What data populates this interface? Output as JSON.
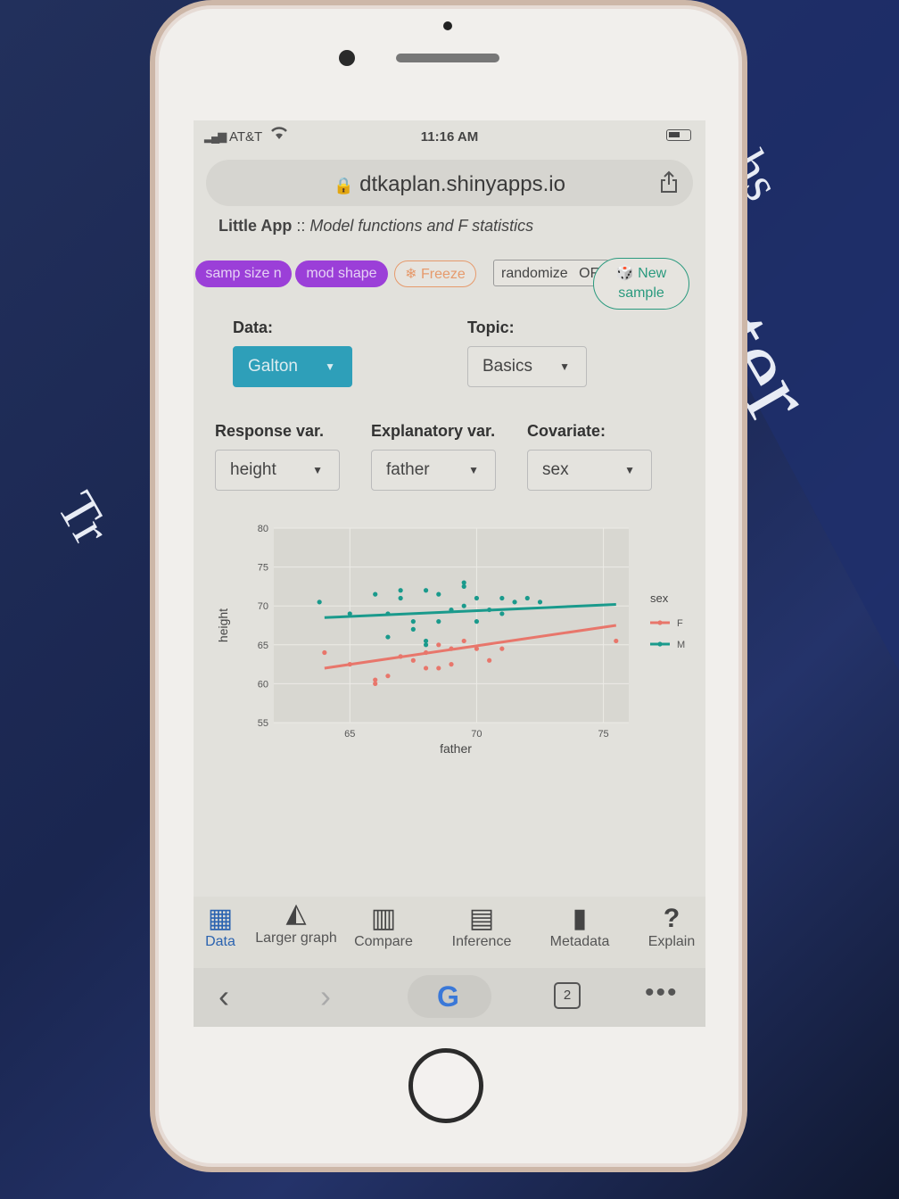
{
  "status": {
    "carrier": "AT&T",
    "time": "11:16 AM"
  },
  "browser": {
    "url": "dtkaplan.shinyapps.io",
    "tab_count": "2"
  },
  "app": {
    "title_bold": "Little App",
    "title_sep": "::",
    "title_italic": "Model functions and F statistics"
  },
  "controls": {
    "samp_size": "samp size n",
    "mod_shape": "mod shape",
    "freeze": "Freeze",
    "randomize": "randomize",
    "randomize_state": "OF",
    "new_sample": "New sample"
  },
  "fields": {
    "data_label": "Data:",
    "data_value": "Galton",
    "topic_label": "Topic:",
    "topic_value": "Basics",
    "response_label": "Response var.",
    "response_value": "height",
    "explanatory_label": "Explanatory var.",
    "explanatory_value": "father",
    "covariate_label": "Covariate:",
    "covariate_value": "sex"
  },
  "colors": {
    "female": "#e8766b",
    "male": "#1a9a8c",
    "accent_purple": "#9b3fd8",
    "shiny_blue": "#2e9fb9"
  },
  "chart_data": {
    "type": "scatter",
    "xlabel": "father",
    "ylabel": "height",
    "xlim": [
      62,
      76
    ],
    "ylim": [
      55,
      80
    ],
    "x_ticks": [
      65,
      70,
      75
    ],
    "y_ticks": [
      55,
      60,
      65,
      70,
      75,
      80
    ],
    "legend": {
      "title": "sex",
      "position": "right",
      "entries": [
        "F",
        "M"
      ]
    },
    "series": [
      {
        "name": "F",
        "color": "#e8766b",
        "points": [
          [
            64.0,
            64.0
          ],
          [
            65.0,
            62.5
          ],
          [
            66.0,
            60.5
          ],
          [
            66.5,
            61.0
          ],
          [
            67.0,
            63.5
          ],
          [
            67.5,
            63.0
          ],
          [
            68.0,
            64.0
          ],
          [
            68.0,
            62.0
          ],
          [
            68.5,
            62.0
          ],
          [
            68.5,
            65.0
          ],
          [
            69.0,
            64.5
          ],
          [
            69.0,
            62.5
          ],
          [
            69.5,
            65.5
          ],
          [
            70.0,
            64.5
          ],
          [
            70.5,
            63.0
          ],
          [
            71.0,
            64.5
          ],
          [
            75.5,
            65.5
          ],
          [
            66.0,
            60.0
          ]
        ],
        "fit": [
          [
            64.0,
            62.0
          ],
          [
            75.5,
            67.5
          ]
        ]
      },
      {
        "name": "M",
        "color": "#1a9a8c",
        "points": [
          [
            63.8,
            70.5
          ],
          [
            65.0,
            69.0
          ],
          [
            66.0,
            71.5
          ],
          [
            66.5,
            69.0
          ],
          [
            67.0,
            72.0
          ],
          [
            67.5,
            68.0
          ],
          [
            67.5,
            67.0
          ],
          [
            68.0,
            72.0
          ],
          [
            68.0,
            65.0
          ],
          [
            68.5,
            71.5
          ],
          [
            68.5,
            68.0
          ],
          [
            69.0,
            69.5
          ],
          [
            69.5,
            73.0
          ],
          [
            69.5,
            72.5
          ],
          [
            69.5,
            70.0
          ],
          [
            70.0,
            71.0
          ],
          [
            70.0,
            68.0
          ],
          [
            70.5,
            69.5
          ],
          [
            71.0,
            69.0
          ],
          [
            71.0,
            71.0
          ],
          [
            71.5,
            70.5
          ],
          [
            72.0,
            71.0
          ],
          [
            72.5,
            70.5
          ],
          [
            66.5,
            66.0
          ],
          [
            67.0,
            71.0
          ],
          [
            68.0,
            65.5
          ]
        ],
        "fit": [
          [
            64.0,
            68.5
          ],
          [
            75.5,
            70.2
          ]
        ]
      }
    ]
  },
  "tabs": [
    {
      "label": "Data",
      "icon": "grid-icon"
    },
    {
      "label": "Larger graph",
      "icon": "area-chart-icon"
    },
    {
      "label": "Compare",
      "icon": "map-icon"
    },
    {
      "label": "Inference",
      "icon": "calculator-icon"
    },
    {
      "label": "Metadata",
      "icon": "book-icon"
    },
    {
      "label": "Explain",
      "icon": "question-icon"
    }
  ],
  "background": {
    "text_a": "aphs",
    "text_b": "ter",
    "text_c": "Tr"
  }
}
